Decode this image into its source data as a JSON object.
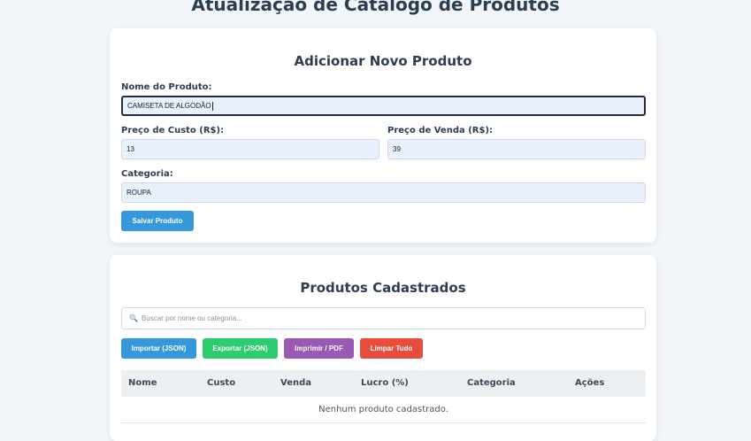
{
  "page": {
    "title": "Atualização de Catálogo de Produtos"
  },
  "form": {
    "title": "Adicionar Novo Produto",
    "name_label": "Nome do Produto:",
    "name_value": "CAMISETA DE ALGODÃO",
    "cost_label": "Preço de Custo (R$):",
    "cost_value": "13",
    "price_label": "Preço de Venda (R$):",
    "price_value": "39",
    "category_label": "Categoria:",
    "category_value": "ROUPA",
    "save_label": "Salvar Produto"
  },
  "list": {
    "title": "Produtos Cadastrados",
    "search_placeholder": "Buscar por nome ou categoria...",
    "search_icon": "search-icon",
    "buttons": {
      "import": "Importar (JSON)",
      "export": "Exportar (JSON)",
      "print": "Imprimir / PDF",
      "clear": "Limpar Tudo"
    },
    "columns": [
      "Nome",
      "Custo",
      "Venda",
      "Lucro (%)",
      "Categoria",
      "Ações"
    ],
    "empty_message": "Nenhum produto cadastrado."
  },
  "colors": {
    "import": "#3498db",
    "export": "#2ecc71",
    "print": "#9b59b6",
    "clear": "#e74c3c",
    "save": "#3498db"
  }
}
